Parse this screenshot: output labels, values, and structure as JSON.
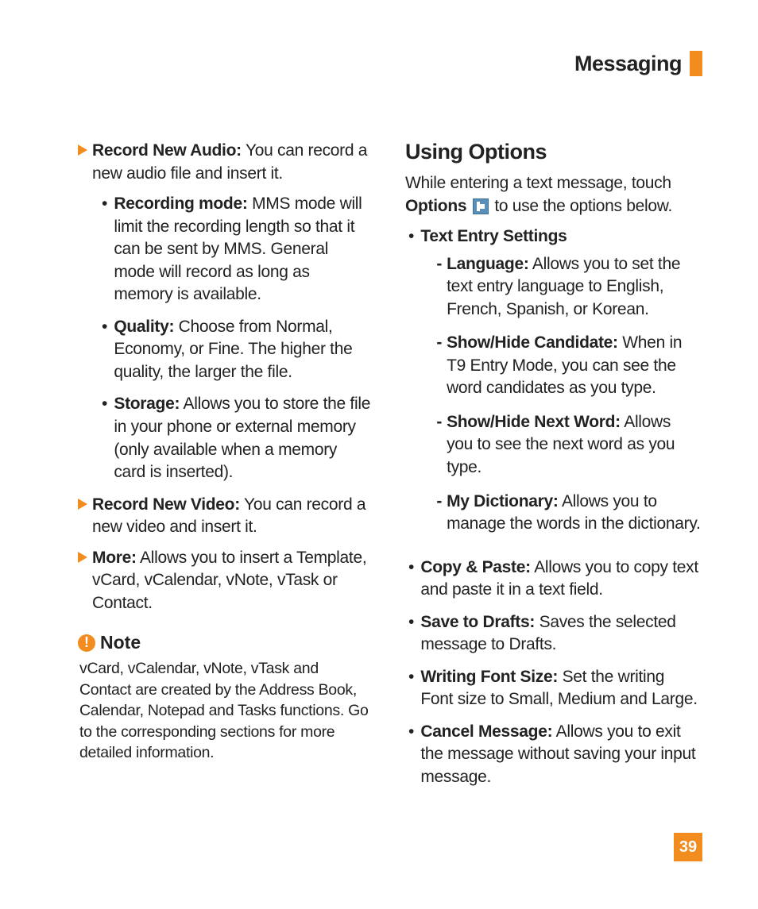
{
  "header": {
    "title": "Messaging"
  },
  "left": {
    "recordAudio": {
      "label": "Record New Audio:",
      "desc": " You can record a new audio file and insert it.",
      "sub": {
        "recordingMode": {
          "label": "Recording mode:",
          "desc": " MMS mode will limit the recording length so that it can be sent by MMS. General mode will record as long as memory is available."
        },
        "quality": {
          "label": "Quality:",
          "desc": " Choose from Normal, Economy, or Fine. The higher the quality, the larger the file."
        },
        "storage": {
          "label": "Storage:",
          "desc": " Allows you to store the file in your phone or external memory (only available when a memory card is inserted)."
        }
      }
    },
    "recordVideo": {
      "label": "Record New Video:",
      "desc": " You can record a new video and insert it."
    },
    "more": {
      "label": "More:",
      "desc": " Allows you to insert a Template, vCard, vCalendar, vNote, vTask or Contact."
    },
    "note": {
      "title": "Note",
      "body": "vCard, vCalendar, vNote, vTask and Contact are created by the Address Book, Calendar, Notepad and Tasks functions. Go to the corresponding sections for more detailed information."
    }
  },
  "right": {
    "heading": "Using Options",
    "intro1": "While entering a text message, touch ",
    "optionsLabel": "Options",
    "intro2": " to use the options below.",
    "textEntry": {
      "label": "Text Entry Settings",
      "language": {
        "label": "Language:",
        "desc": " Allows you to set the text entry language to English, French, Spanish, or Korean."
      },
      "showHideCandidate": {
        "label": "Show/Hide Candidate:",
        "desc": " When in T9 Entry Mode, you can see the word candidates as you type."
      },
      "showHideNextWord": {
        "label": "Show/Hide Next Word:",
        "desc": " Allows you to see the next word as you type."
      },
      "myDictionary": {
        "label": "My Dictionary:",
        "desc": " Allows you to manage the words in the dictionary."
      }
    },
    "copyPaste": {
      "label": "Copy & Paste:",
      "desc": " Allows you to copy text and paste it in a text field."
    },
    "saveDrafts": {
      "label": "Save to Drafts:",
      "desc": " Saves the selected message to Drafts."
    },
    "fontSize": {
      "label": "Writing Font Size:",
      "desc": " Set the writing Font size to Small, Medium and Large."
    },
    "cancel": {
      "label": "Cancel Message:",
      "desc": " Allows you to exit the message without saving your input message."
    }
  },
  "pageNumber": "39"
}
